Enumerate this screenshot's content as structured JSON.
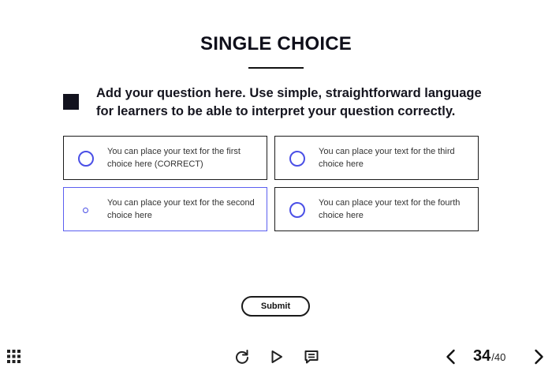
{
  "title": "SINGLE CHOICE",
  "question": "Add your question here. Use simple, straightforward language for learners to be able to interpret your question correctly.",
  "choices": [
    {
      "text": "You can place your text for the first choice here (CORRECT)",
      "selected": false
    },
    {
      "text": "You can place your text for the second choice here",
      "selected": true
    },
    {
      "text": "You can place your text for the third choice here",
      "selected": false
    },
    {
      "text": "You can place your text for the fourth choice here",
      "selected": false
    }
  ],
  "submit_label": "Submit",
  "pagination": {
    "current": "34",
    "separator": "/",
    "total": "40"
  },
  "icons": {
    "menu": "grid-icon",
    "replay": "reload-icon",
    "play": "play-icon",
    "notes": "chat-icon",
    "prev": "chevron-left-icon",
    "next": "chevron-right-icon"
  },
  "colors": {
    "accent": "#4a4fe6",
    "text": "#15151f",
    "border": "#1b1b1b",
    "selected_border": "#5b5ff0"
  }
}
